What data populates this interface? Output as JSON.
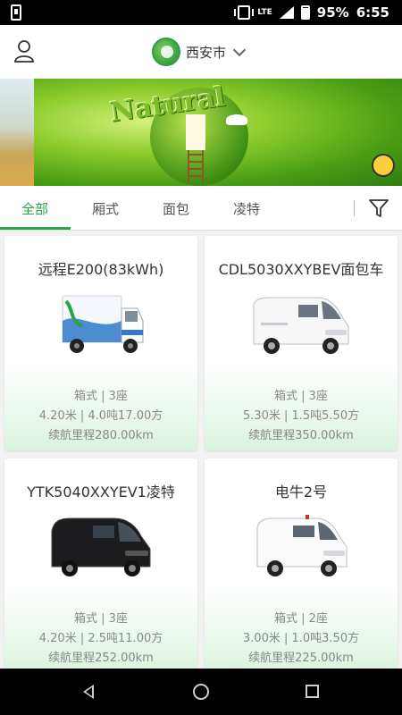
{
  "status_bar": {
    "network": "LTE",
    "battery": "95%",
    "time": "6:55"
  },
  "header": {
    "city": "西安市",
    "icons": [
      "user-icon",
      "app-logo",
      "chevron-down-icon"
    ]
  },
  "banner": {
    "text": "Natural"
  },
  "tabs": [
    {
      "label": "全部",
      "active": true
    },
    {
      "label": "厢式",
      "active": false
    },
    {
      "label": "面包",
      "active": false
    },
    {
      "label": "凌特",
      "active": false
    }
  ],
  "filter_icon": "filter-icon",
  "vehicles": [
    {
      "name": "远程E200(83kWh)",
      "type_seats": "箱式 | 3座",
      "specs": "4.20米 | 4.0吨17.00方",
      "range": "续航里程280.00km",
      "image": "box-truck"
    },
    {
      "name": "CDL5030XXYBEV面包车",
      "type_seats": "箱式 | 3座",
      "specs": "5.30米 | 1.5吨5.50方",
      "range": "续航里程350.00km",
      "image": "white-van"
    },
    {
      "name": "YTK5040XXYEV1凌特",
      "type_seats": "箱式 | 3座",
      "specs": "4.20米 | 2.5吨11.00方",
      "range": "续航里程252.00km",
      "image": "black-van"
    },
    {
      "name": "电牛2号",
      "type_seats": "箱式 | 2座",
      "specs": "3.00米 | 1.0吨3.50方",
      "range": "续航里程225.00km",
      "image": "white-minivan"
    }
  ],
  "colors": {
    "accent": "#2aa34a",
    "text_primary": "#333333",
    "text_secondary": "#888888"
  }
}
